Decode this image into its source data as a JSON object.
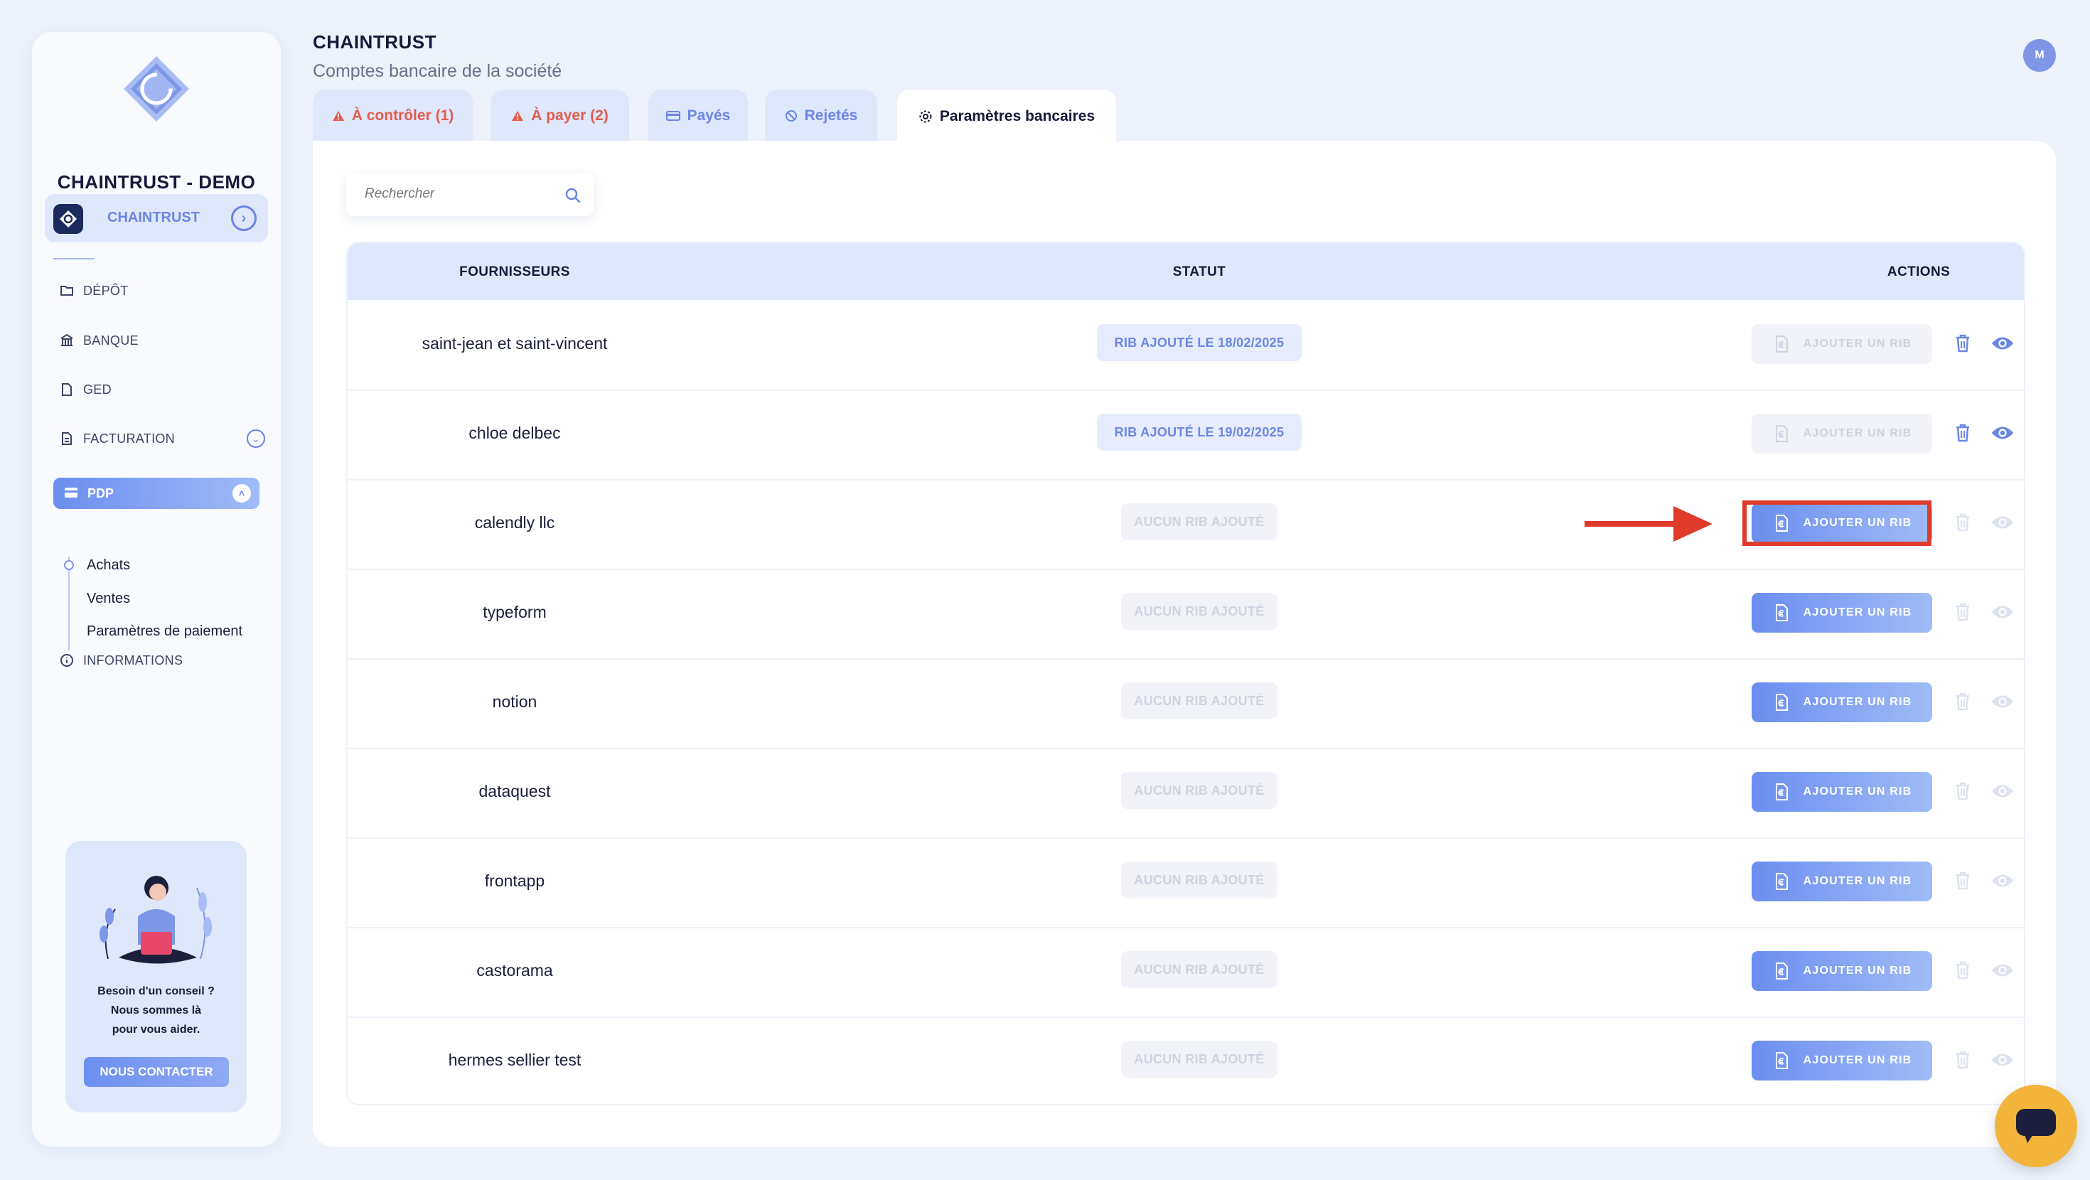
{
  "sidebar": {
    "company_name": "CHAINTRUST - DEMO",
    "company_switch_label": "CHAINTRUST",
    "nav": {
      "depot": "DÉPÔT",
      "banque": "BANQUE",
      "ged": "GED",
      "facturation": "FACTURATION",
      "pdp": "PDP",
      "informations": "INFORMATIONS"
    },
    "subnav": [
      "Achats",
      "Ventes",
      "Paramètres de paiement"
    ],
    "help": {
      "line1": "Besoin d'un conseil ?",
      "line2": "Nous sommes là",
      "line3": "pour vous aider.",
      "button": "NOUS CONTACTER"
    }
  },
  "header": {
    "title": "CHAINTRUST",
    "subtitle": "Comptes bancaire de la société",
    "avatar_initial": "M"
  },
  "tabs": [
    {
      "label": "À contrôler (1)",
      "icon": "warning-icon",
      "color": "#e25b4e"
    },
    {
      "label": "À payer (2)",
      "icon": "warning-icon",
      "color": "#e25b4e"
    },
    {
      "label": "Payés",
      "icon": "card-icon",
      "color": "#6a86e4"
    },
    {
      "label": "Rejetés",
      "icon": "blocked-icon",
      "color": "#6a86e4"
    },
    {
      "label": "Paramètres bancaires",
      "icon": "gear-icon",
      "active": true
    }
  ],
  "search": {
    "placeholder": "Rechercher"
  },
  "table": {
    "headers": {
      "suppliers": "FOURNISSEURS",
      "status": "STATUT",
      "actions": "ACTIONS"
    },
    "add_label": "AJOUTER UN RIB",
    "rows": [
      {
        "name": "saint-jean et saint-vincent",
        "status": "RIB AJOUTÉ LE 18/02/2025",
        "has_rib": true
      },
      {
        "name": "chloe delbec",
        "status": "RIB AJOUTÉ LE 19/02/2025",
        "has_rib": true
      },
      {
        "name": "calendly llc",
        "status": "AUCUN RIB AJOUTÉ",
        "has_rib": false,
        "highlighted": true
      },
      {
        "name": "typeform",
        "status": "AUCUN RIB AJOUTÉ",
        "has_rib": false
      },
      {
        "name": "notion",
        "status": "AUCUN RIB AJOUTÉ",
        "has_rib": false
      },
      {
        "name": "dataquest",
        "status": "AUCUN RIB AJOUTÉ",
        "has_rib": false
      },
      {
        "name": "frontapp",
        "status": "AUCUN RIB AJOUTÉ",
        "has_rib": false
      },
      {
        "name": "castorama",
        "status": "AUCUN RIB AJOUTÉ",
        "has_rib": false
      },
      {
        "name": "hermes sellier test",
        "status": "AUCUN RIB AJOUTÉ",
        "has_rib": false
      }
    ]
  },
  "colors": {
    "accent": "#6a86e4",
    "warning": "#e25b4e",
    "highlight": "#e03a2c",
    "chat": "#f3b43b"
  }
}
